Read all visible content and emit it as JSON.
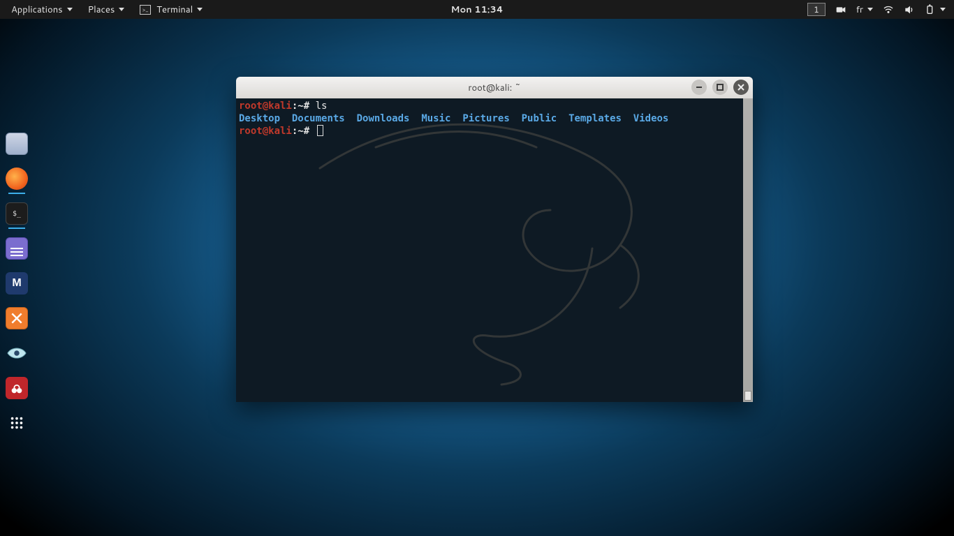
{
  "topbar": {
    "applications": "Applications",
    "places": "Places",
    "terminal": "Terminal",
    "clock": "Mon 11:34",
    "workspace": "1",
    "lang": "fr"
  },
  "dock": {
    "items": [
      "files",
      "firefox",
      "terminal",
      "gedit",
      "metasploit",
      "burpsuite",
      "zenmap",
      "cherrytree",
      "apps"
    ]
  },
  "window": {
    "title": "root@kali: ~"
  },
  "terminal": {
    "prompt": {
      "user_host": "root@kali",
      "sep": ":",
      "path": "~",
      "hash": "#"
    },
    "command1": "ls",
    "listing": [
      "Desktop",
      "Documents",
      "Downloads",
      "Music",
      "Pictures",
      "Public",
      "Templates",
      "Videos"
    ]
  },
  "colors": {
    "dir_blue": "#5aa9e6",
    "prompt_red": "#c0392b",
    "accent": "#3daee9"
  }
}
